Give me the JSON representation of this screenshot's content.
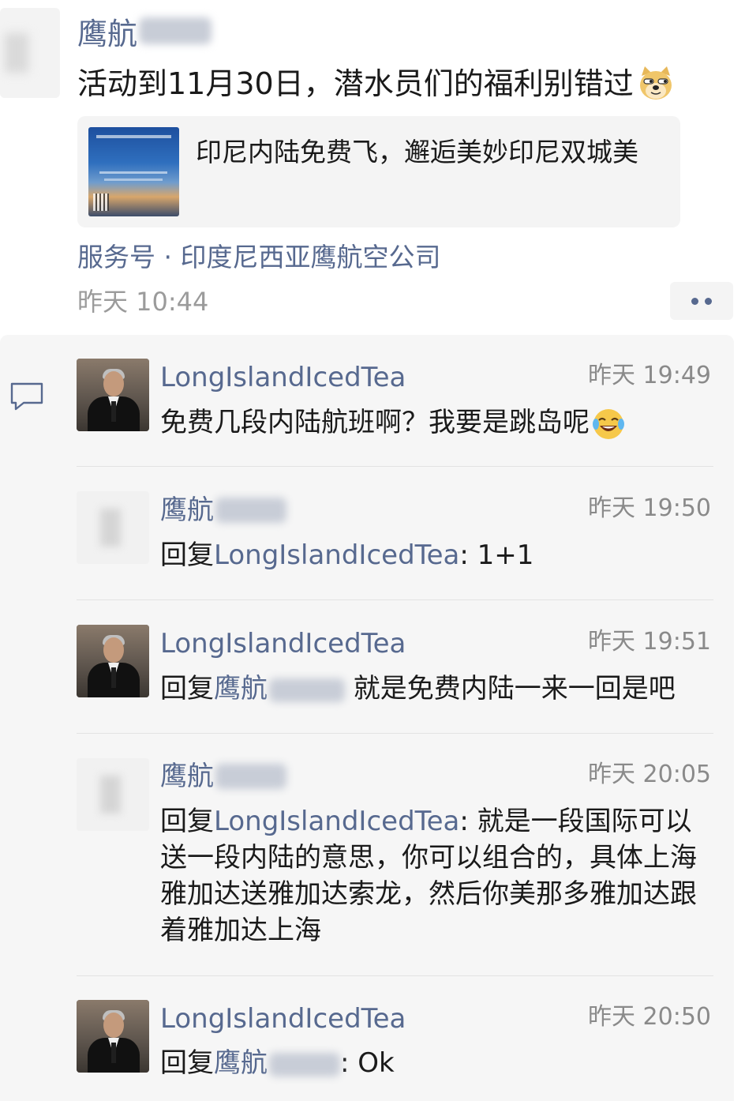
{
  "post": {
    "author_visible": "鹰航",
    "text": "活动到11月30日，潜水员们的福利别错过",
    "emoji": "doge-emoji",
    "share_card": {
      "title": "印尼内陆免费飞，邂逅美妙印尼双城美"
    },
    "source": "服务号 · 印度尼西亚鹰航空公司",
    "time": "昨天 10:44"
  },
  "comments": [
    {
      "author": "LongIslandIcedTea",
      "time": "昨天 19:49",
      "text": "免费几段内陆航班啊？我要是跳岛呢",
      "emoji": "laughing-tears-emoji"
    },
    {
      "author": "鹰航",
      "time": "昨天 19:50",
      "reply_prefix": "回复",
      "reply_to": "LongIslandIcedTea",
      "text": ": 1+1"
    },
    {
      "author": "LongIslandIcedTea",
      "time": "昨天 19:51",
      "reply_prefix": "回复",
      "reply_to": "鹰航",
      "text": " 就是免费内陆一来一回是吧"
    },
    {
      "author": "鹰航",
      "time": "昨天 20:05",
      "reply_prefix": "回复",
      "reply_to": "LongIslandIcedTea",
      "text": ": 就是一段国际可以送一段内陆的意思，你可以组合的，具体上海雅加达送雅加达索龙，然后你美那多雅加达跟着雅加达上海"
    },
    {
      "author": "LongIslandIcedTea",
      "time": "昨天 20:50",
      "reply_prefix": "回复",
      "reply_to": "鹰航",
      "text": ": Ok"
    }
  ],
  "colors": {
    "link": "#57698f",
    "text": "#1a1a1a",
    "time": "#8a8a8a",
    "panel": "#f6f6f6"
  }
}
